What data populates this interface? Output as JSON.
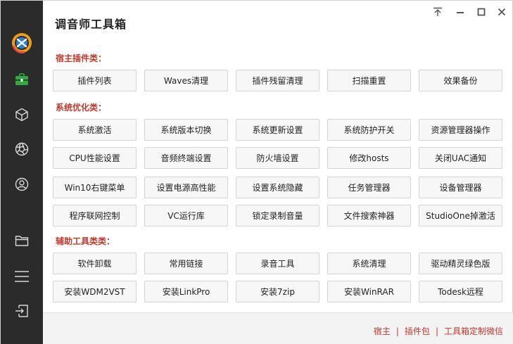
{
  "app": {
    "title": "调音师工具箱"
  },
  "colors": {
    "sidebar_bg": "#2b2b2b",
    "accent_red": "#c0392b",
    "active_green": "#2eaa3f",
    "button_bg": "#f7f7f7"
  },
  "sidebar": {
    "items": [
      {
        "icon": "logo-icon"
      },
      {
        "icon": "toolbox-icon",
        "active": true
      },
      {
        "icon": "cube-icon"
      },
      {
        "icon": "aperture-icon"
      },
      {
        "icon": "user-icon"
      },
      {
        "icon": "folder-icon"
      },
      {
        "icon": "menu-icon"
      },
      {
        "icon": "exit-icon"
      }
    ]
  },
  "window_controls": [
    {
      "icon": "pin-top-icon"
    },
    {
      "icon": "minimize-icon"
    },
    {
      "icon": "maximize-icon"
    },
    {
      "icon": "close-icon"
    }
  ],
  "sections": [
    {
      "title": "宿主插件类：",
      "buttons": [
        "插件列表",
        "Waves清理",
        "插件残留清理",
        "扫描重置",
        "效果备份"
      ]
    },
    {
      "title": "系统优化类：",
      "buttons": [
        "系统激活",
        "系统版本切换",
        "系统更新设置",
        "系统防护开关",
        "资源管理器操作",
        "CPU性能设置",
        "音频终端设置",
        "防火墙设置",
        "修改hosts",
        "关闭UAC通知",
        "Win10右键菜单",
        "设置电源高性能",
        "设置系统隐藏",
        "任务管理器",
        "设备管理器",
        "程序联网控制",
        "VC运行库",
        "锁定录制音量",
        "文件搜索神器",
        "StudioOne掉激活"
      ]
    },
    {
      "title": "辅助工具类类：",
      "buttons": [
        "软件卸载",
        "常用链接",
        "录音工具",
        "系统清理",
        "驱动精灵绿色版",
        "安装WDM2VST",
        "安装LinkPro",
        "安装7zip",
        "安装WinRAR",
        "Todesk远程"
      ]
    }
  ],
  "footer": {
    "links": [
      "宿主",
      "插件包",
      "工具箱定制微信"
    ],
    "separator": "|"
  }
}
